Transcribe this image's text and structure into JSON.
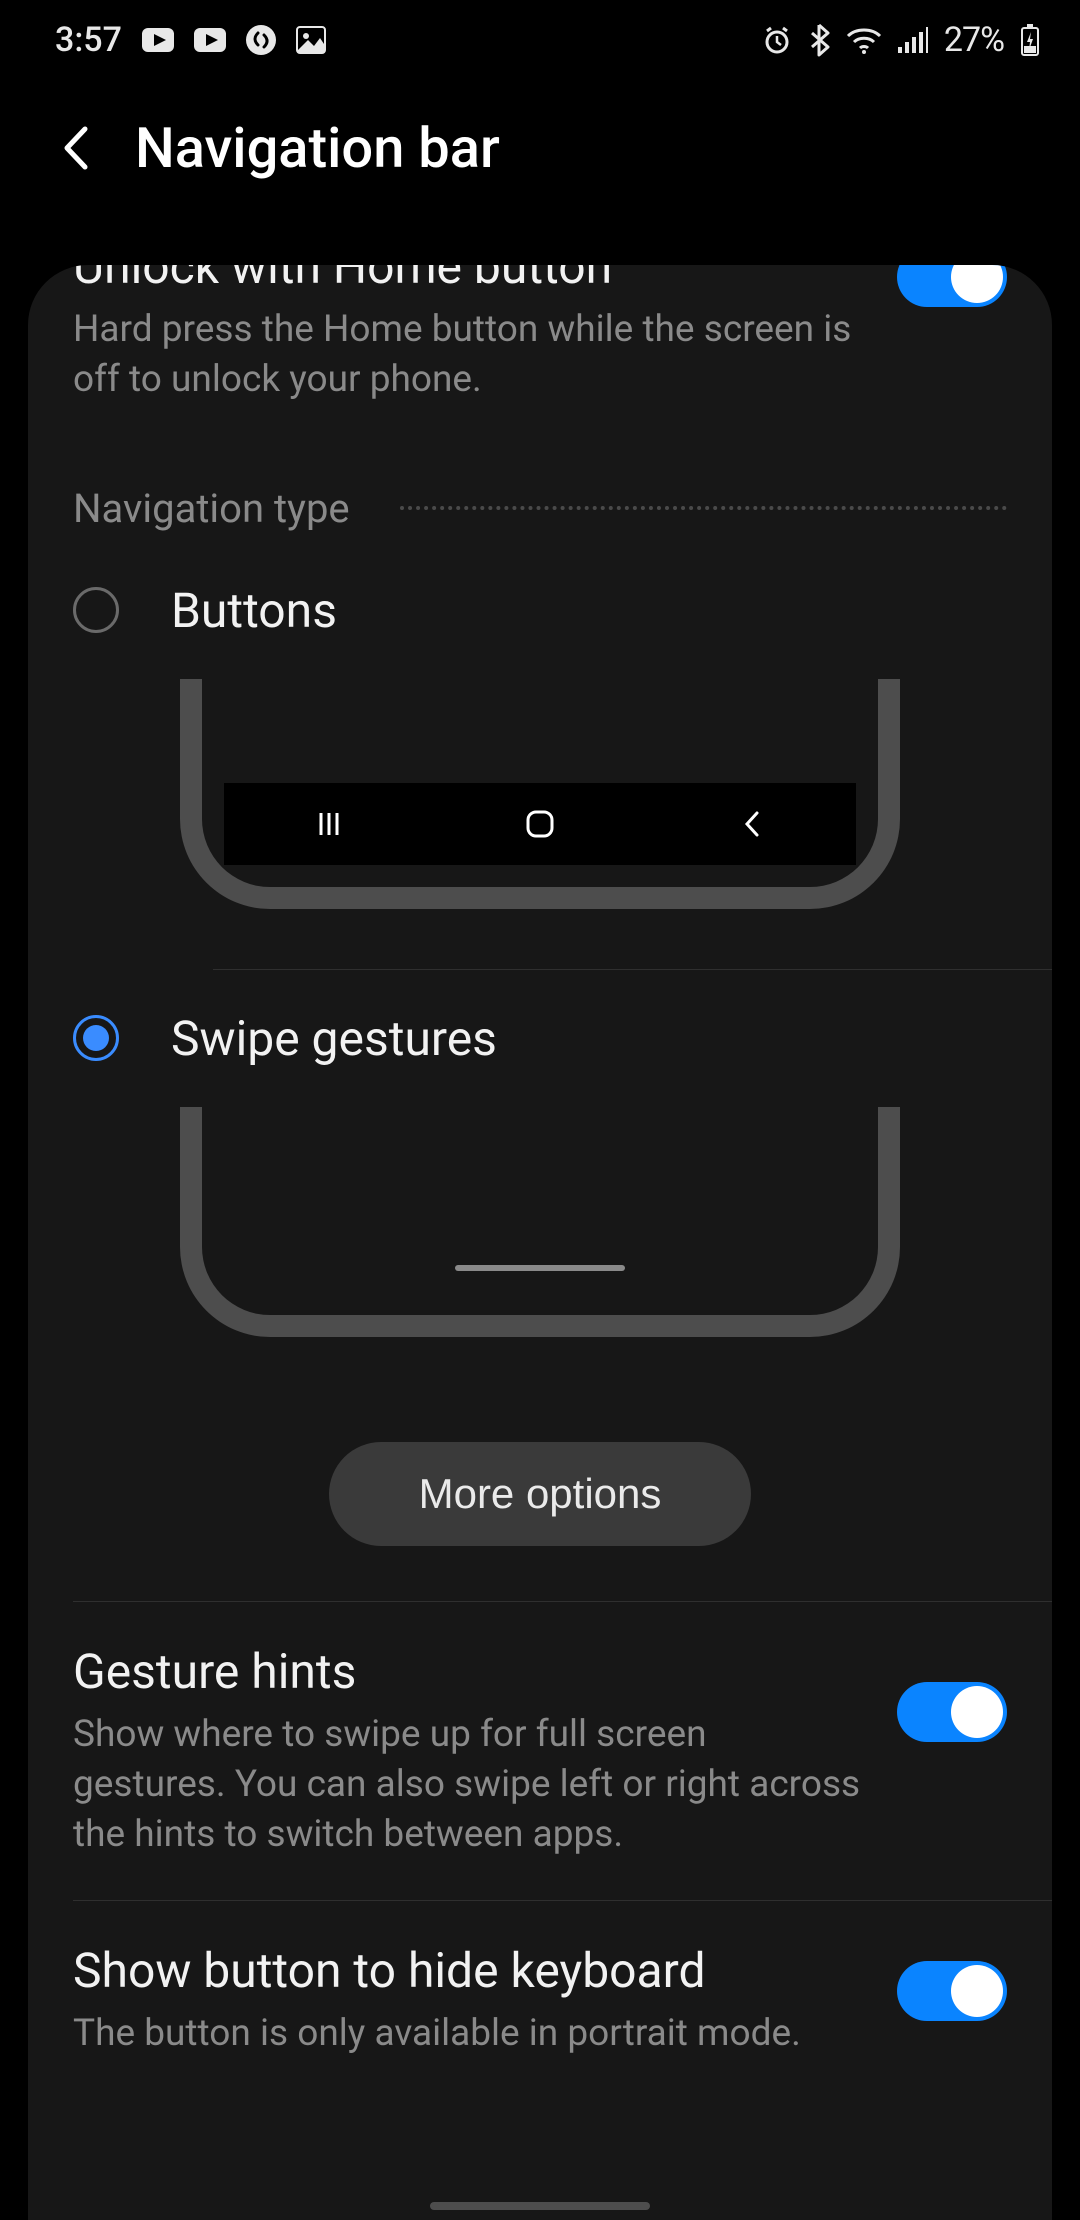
{
  "status": {
    "time": "3:57",
    "battery_pct": "27%"
  },
  "header": {
    "title": "Navigation bar"
  },
  "unlock": {
    "title": "Unlock with Home button",
    "desc": "Hard press the Home button while the screen is off to unlock your phone.",
    "enabled": true
  },
  "nav_type": {
    "section_label": "Navigation type",
    "buttons_label": "Buttons",
    "swipe_label": "Swipe gestures",
    "selected": "swipe",
    "more_options": "More options"
  },
  "gesture_hints": {
    "title": "Gesture hints",
    "desc": "Show where to swipe up for full screen gestures. You can also swipe left or right across the hints to switch between apps.",
    "enabled": true
  },
  "hide_keyboard": {
    "title": "Show button to hide keyboard",
    "desc": "The button is only available in portrait mode.",
    "enabled": true
  }
}
